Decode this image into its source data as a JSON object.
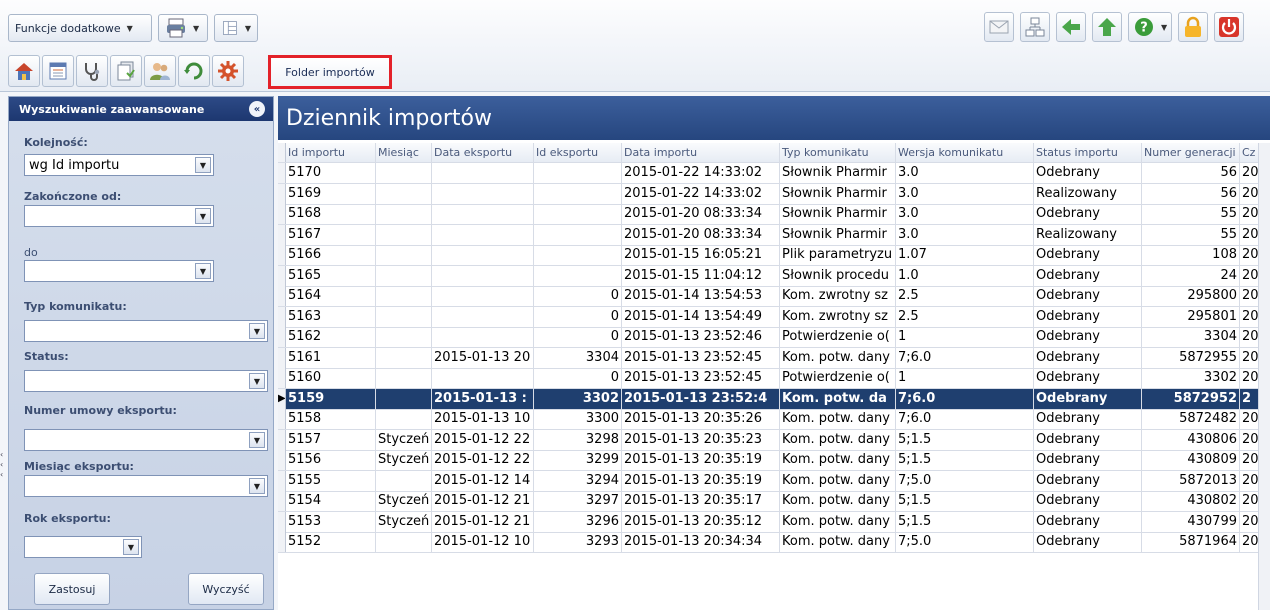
{
  "toolbar": {
    "extra_functions_label": "Funkcje dodatkowe",
    "folder_tab_label": "Folder importów",
    "caret": "▼"
  },
  "search_panel": {
    "title": "Wyszukiwanie zaawansowane",
    "collapse_glyph": "«",
    "order_label": "Kolejność:",
    "order_value": "wg Id importu",
    "finished_from_label": "Zakończone od:",
    "finished_from_value": "",
    "to_label": "do",
    "to_value": "",
    "message_type_label": "Typ komunikatu:",
    "message_type_value": "",
    "status_label": "Status:",
    "status_value": "",
    "contract_number_label": "Numer umowy eksportu:",
    "contract_number_value": "",
    "export_month_label": "Miesiąc eksportu:",
    "export_month_value": "",
    "export_year_label": "Rok eksportu:",
    "export_year_value": "",
    "apply_label": "Zastosuj",
    "clear_label": "Wyczyść"
  },
  "journal": {
    "title": "Dziennik importów",
    "columns": [
      "Id importu",
      "Miesiąc",
      "Data eksportu",
      "Id eksportu",
      "Data importu",
      "Typ komunikatu",
      "Wersja komunikatu",
      "Status importu",
      "Numer generacji",
      "Cz"
    ],
    "selected_row": 11,
    "selected_marker": "▶",
    "rows": [
      [
        "5170",
        "",
        "",
        "",
        "2015-01-22 14:33:02",
        "Słownik Pharmir",
        "3.0",
        "Odebrany",
        "56",
        "20"
      ],
      [
        "5169",
        "",
        "",
        "",
        "2015-01-22 14:33:02",
        "Słownik Pharmir",
        "3.0",
        "Realizowany",
        "56",
        "20"
      ],
      [
        "5168",
        "",
        "",
        "",
        "2015-01-20 08:33:34",
        "Słownik Pharmir",
        "3.0",
        "Odebrany",
        "55",
        "20"
      ],
      [
        "5167",
        "",
        "",
        "",
        "2015-01-20 08:33:34",
        "Słownik Pharmir",
        "3.0",
        "Realizowany",
        "55",
        "20"
      ],
      [
        "5166",
        "",
        "",
        "",
        "2015-01-15 16:05:21",
        "Plik parametryzu",
        "1.07",
        "Odebrany",
        "108",
        "20"
      ],
      [
        "5165",
        "",
        "",
        "",
        "2015-01-15 11:04:12",
        "Słownik procedu",
        "1.0",
        "Odebrany",
        "24",
        "20"
      ],
      [
        "5164",
        "",
        "",
        "0",
        "2015-01-14 13:54:53",
        "Kom. zwrotny sz",
        "2.5",
        "Odebrany",
        "295800",
        "20"
      ],
      [
        "5163",
        "",
        "",
        "0",
        "2015-01-14 13:54:49",
        "Kom. zwrotny sz",
        "2.5",
        "Odebrany",
        "295801",
        "20"
      ],
      [
        "5162",
        "",
        "",
        "0",
        "2015-01-13 23:52:46",
        "Potwierdzenie o(",
        "1",
        "Odebrany",
        "3304",
        "20"
      ],
      [
        "5161",
        "",
        "2015-01-13 20",
        "3304",
        "2015-01-13 23:52:45",
        "Kom. potw. dany",
        "7;6.0",
        "Odebrany",
        "5872955",
        "20"
      ],
      [
        "5160",
        "",
        "",
        "0",
        "2015-01-13 23:52:45",
        "Potwierdzenie o(",
        "1",
        "Odebrany",
        "3302",
        "20"
      ],
      [
        "5159",
        "",
        "2015-01-13 :",
        "3302",
        "2015-01-13 23:52:4",
        "Kom. potw. da",
        "7;6.0",
        "Odebrany",
        "5872952",
        "2"
      ],
      [
        "5158",
        "",
        "2015-01-13 10",
        "3300",
        "2015-01-13 20:35:26",
        "Kom. potw. dany",
        "7;6.0",
        "Odebrany",
        "5872482",
        "20"
      ],
      [
        "5157",
        "Styczeń",
        "2015-01-12 22",
        "3298",
        "2015-01-13 20:35:23",
        "Kom. potw. dany",
        "5;1.5",
        "Odebrany",
        "430806",
        "20"
      ],
      [
        "5156",
        "Styczeń",
        "2015-01-12 22",
        "3299",
        "2015-01-13 20:35:19",
        "Kom. potw. dany",
        "5;1.5",
        "Odebrany",
        "430809",
        "20"
      ],
      [
        "5155",
        "",
        "2015-01-12 14",
        "3294",
        "2015-01-13 20:35:19",
        "Kom. potw. dany",
        "7;5.0",
        "Odebrany",
        "5872013",
        "20"
      ],
      [
        "5154",
        "Styczeń",
        "2015-01-12 21",
        "3297",
        "2015-01-13 20:35:17",
        "Kom. potw. dany",
        "5;1.5",
        "Odebrany",
        "430802",
        "20"
      ],
      [
        "5153",
        "Styczeń",
        "2015-01-12 21",
        "3296",
        "2015-01-13 20:35:12",
        "Kom. potw. dany",
        "5;1.5",
        "Odebrany",
        "430799",
        "20"
      ],
      [
        "5152",
        "",
        "2015-01-12 10",
        "3293",
        "2015-01-13 20:34:34",
        "Kom. potw. dany",
        "7;5.0",
        "Odebrany",
        "5871964",
        "20"
      ]
    ]
  }
}
